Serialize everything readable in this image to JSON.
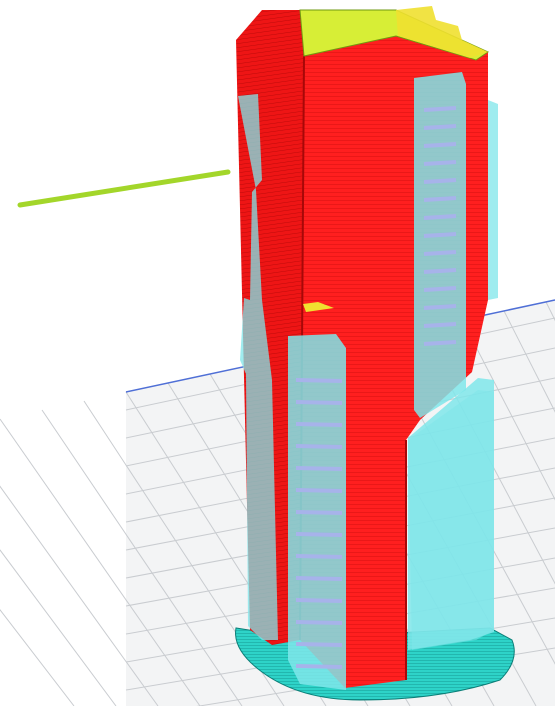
{
  "app": {
    "view": "slicer-preview-3d"
  },
  "colors": {
    "left_panel": "#ffffff",
    "bed": "#f3f4f5",
    "bed_grid": "#c9ccd0",
    "bed_edge": "#4f6fd6",
    "perimeter": "#ff1f1f",
    "perimeter_dark": "#d40e0e",
    "support": "#7fe6ea",
    "support_line": "#a7b3ea",
    "travel": "#a3d62a",
    "top_solid": "#c7e62a",
    "brim": "#2ed3c8",
    "ironing": "#f0e030"
  },
  "layers": {
    "object": "perimeter",
    "support": "support-material",
    "travel_move": "travel",
    "skirt": "brim"
  }
}
